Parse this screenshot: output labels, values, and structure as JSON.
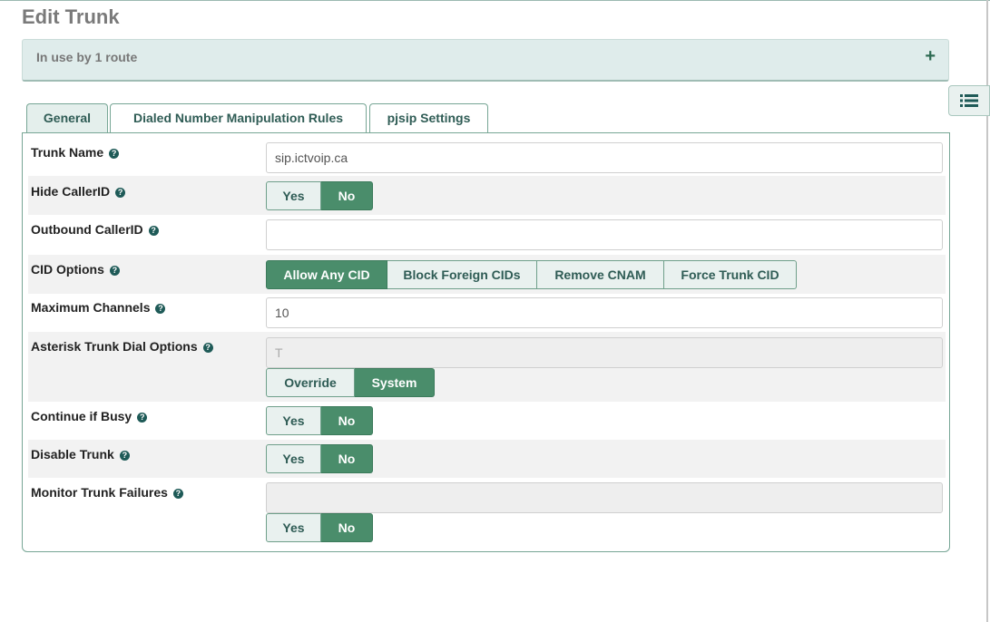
{
  "page": {
    "title": "Edit Trunk"
  },
  "route_panel": {
    "text": "In use by 1 route",
    "expand_symbol": "+"
  },
  "tabs": [
    {
      "label": "General",
      "active": true
    },
    {
      "label": "Dialed Number Manipulation Rules",
      "active": false
    },
    {
      "label": "pjsip Settings",
      "active": false
    }
  ],
  "form": {
    "trunk_name": {
      "label": "Trunk Name",
      "value": "sip.ictvoip.ca"
    },
    "hide_callerid": {
      "label": "Hide CallerID",
      "options": [
        "Yes",
        "No"
      ],
      "selected": "No"
    },
    "outbound_callerid": {
      "label": "Outbound CallerID",
      "value": ""
    },
    "cid_options": {
      "label": "CID Options",
      "options": [
        "Allow Any CID",
        "Block Foreign CIDs",
        "Remove CNAM",
        "Force Trunk CID"
      ],
      "selected": "Allow Any CID"
    },
    "max_channels": {
      "label": "Maximum Channels",
      "value": "10"
    },
    "dial_options": {
      "label": "Asterisk Trunk Dial Options",
      "value": "T",
      "options": [
        "Override",
        "System"
      ],
      "selected": "System"
    },
    "continue_if_busy": {
      "label": "Continue if Busy",
      "options": [
        "Yes",
        "No"
      ],
      "selected": "No"
    },
    "disable_trunk": {
      "label": "Disable Trunk",
      "options": [
        "Yes",
        "No"
      ],
      "selected": "No"
    },
    "monitor_failures": {
      "label": "Monitor Trunk Failures",
      "value": "",
      "options": [
        "Yes",
        "No"
      ],
      "selected": "No"
    }
  },
  "icons": {
    "help": "question-circle-icon",
    "sidebar": "list-icon",
    "expand": "plus-icon"
  },
  "colors": {
    "accent": "#4a8d6b",
    "tab_border": "#77a695",
    "panel_bg": "#dfeceb"
  }
}
